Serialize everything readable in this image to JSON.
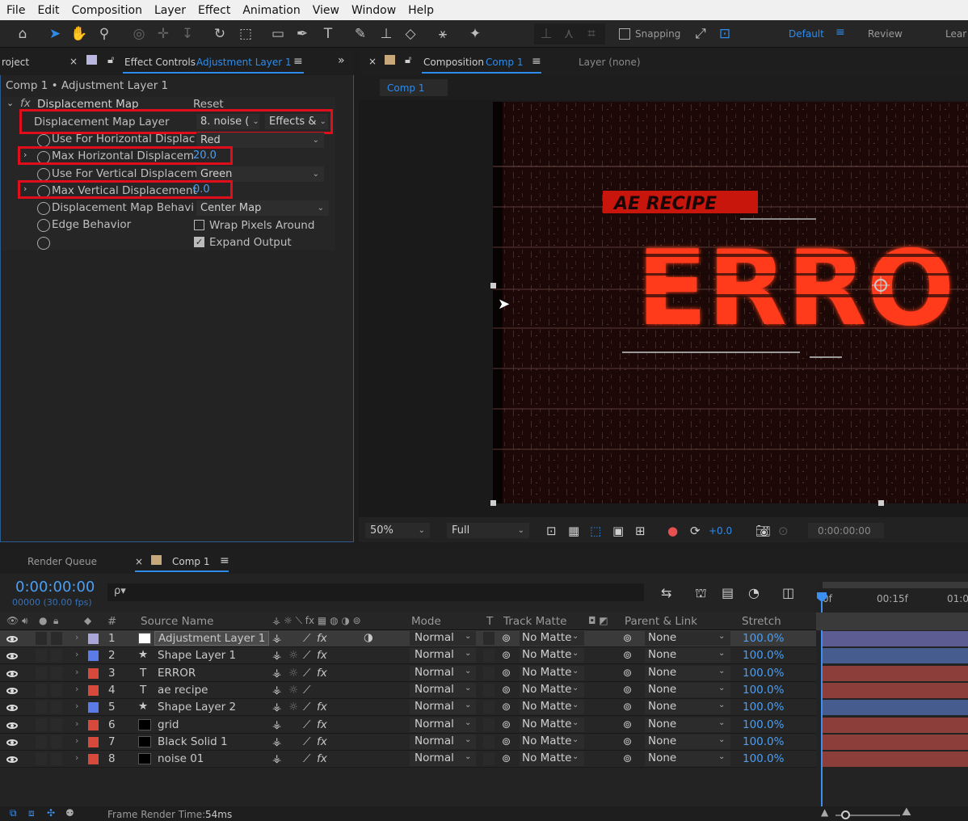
{
  "menu": [
    "File",
    "Edit",
    "Composition",
    "Layer",
    "Effect",
    "Animation",
    "View",
    "Window",
    "Help"
  ],
  "toolbar": {
    "snapping": "Snapping",
    "workspaces": [
      "Default",
      "Review",
      "Lear"
    ]
  },
  "left_panel": {
    "tab_project": "roject",
    "tab_effect_prefix": "Effect Controls",
    "tab_effect_layer": "Adjustment Layer 1",
    "breadcrumb": "Comp 1 • Adjustment Layer 1",
    "effect_name": "Displacement Map",
    "reset": "Reset",
    "props": {
      "map_layer_label": "Displacement Map Layer",
      "map_layer_value": "8. noise (",
      "map_layer_source": "Effects &",
      "use_h_label": "Use For Horizontal Displac",
      "use_h_value": "Red",
      "max_h_label": "Max Horizontal Displacem",
      "max_h_value": "20.0",
      "use_v_label": "Use For Vertical Displacem",
      "use_v_value": "Green",
      "max_v_label": "Max Vertical Displacement",
      "max_v_value": "0.0",
      "behavior_label": "Displacement Map Behavi",
      "behavior_value": "Center Map",
      "edge_label": "Edge Behavior",
      "wrap_label": "Wrap Pixels Around",
      "expand_label": "Expand Output"
    }
  },
  "comp_panel": {
    "tab_prefix": "Composition",
    "tab_name": "Comp 1",
    "layer_tab": "Layer (none)",
    "subtab": "Comp 1",
    "art_small": "AE RECIPE",
    "art_big": "ERRO",
    "zoom": "50%",
    "resolution": "Full",
    "exposure": "+0.0",
    "timecode": "0:00:00:00"
  },
  "timeline": {
    "tab_render": "Render Queue",
    "tab_comp": "Comp 1",
    "timecode": "0:00:00:00",
    "frames": "00000 (30.00 fps)",
    "search_icon_text": "ρ▾",
    "ruler": [
      "0f",
      "00:15f",
      "01:0"
    ],
    "col_hash": "#",
    "col_source": "Source Name",
    "col_mode": "Mode",
    "col_t": "T",
    "col_track": "Track Matte",
    "col_parent": "Parent & Link",
    "col_stretch": "Stretch",
    "layers": [
      {
        "num": "1",
        "type": "solid",
        "name": "Adjustment Layer 1",
        "label": "#a9a7d9",
        "thumb": "#ffffff",
        "mode": "Normal",
        "matte": "No Matte",
        "parent": "None",
        "stretch": "100.0%",
        "bar": "#5d5c92",
        "fx": "yes",
        "selected": "yes"
      },
      {
        "num": "2",
        "type": "star",
        "name": "Shape Layer 1",
        "label": "#5a7be8",
        "thumb": "",
        "mode": "Normal",
        "matte": "No Matte",
        "parent": "None",
        "stretch": "100.0%",
        "bar": "#465c8e",
        "fx": "yes"
      },
      {
        "num": "3",
        "type": "text",
        "name": "ERROR",
        "label": "#d64a3c",
        "thumb": "",
        "mode": "Normal",
        "matte": "No Matte",
        "parent": "None",
        "stretch": "100.0%",
        "bar": "#8c3e3a",
        "fx": "yes"
      },
      {
        "num": "4",
        "type": "text",
        "name": "ae recipe",
        "label": "#d64a3c",
        "thumb": "",
        "mode": "Normal",
        "matte": "No Matte",
        "parent": "None",
        "stretch": "100.0%",
        "bar": "#8c3e3a",
        "fx": "no"
      },
      {
        "num": "5",
        "type": "star",
        "name": "Shape Layer 2",
        "label": "#5a7be8",
        "thumb": "",
        "mode": "Normal",
        "matte": "No Matte",
        "parent": "None",
        "stretch": "100.0%",
        "bar": "#465c8e",
        "fx": "yes"
      },
      {
        "num": "6",
        "type": "solid",
        "name": "grid",
        "label": "#d64a3c",
        "thumb": "#000000",
        "mode": "Normal",
        "matte": "No Matte",
        "parent": "None",
        "stretch": "100.0%",
        "bar": "#8c3e3a",
        "fx": "yes"
      },
      {
        "num": "7",
        "type": "solid",
        "name": "Black Solid 1",
        "label": "#d64a3c",
        "thumb": "#000000",
        "mode": "Normal",
        "matte": "No Matte",
        "parent": "None",
        "stretch": "100.0%",
        "bar": "#8c3e3a",
        "fx": "yes"
      },
      {
        "num": "8",
        "type": "solid",
        "name": "noise 01",
        "label": "#d64a3c",
        "thumb": "#000000",
        "mode": "Normal",
        "matte": "No Matte",
        "parent": "None",
        "stretch": "100.0%",
        "bar": "#8c3e3a",
        "fx": "yes"
      }
    ],
    "status_label": "Frame Render Time:",
    "status_value": "54ms"
  }
}
